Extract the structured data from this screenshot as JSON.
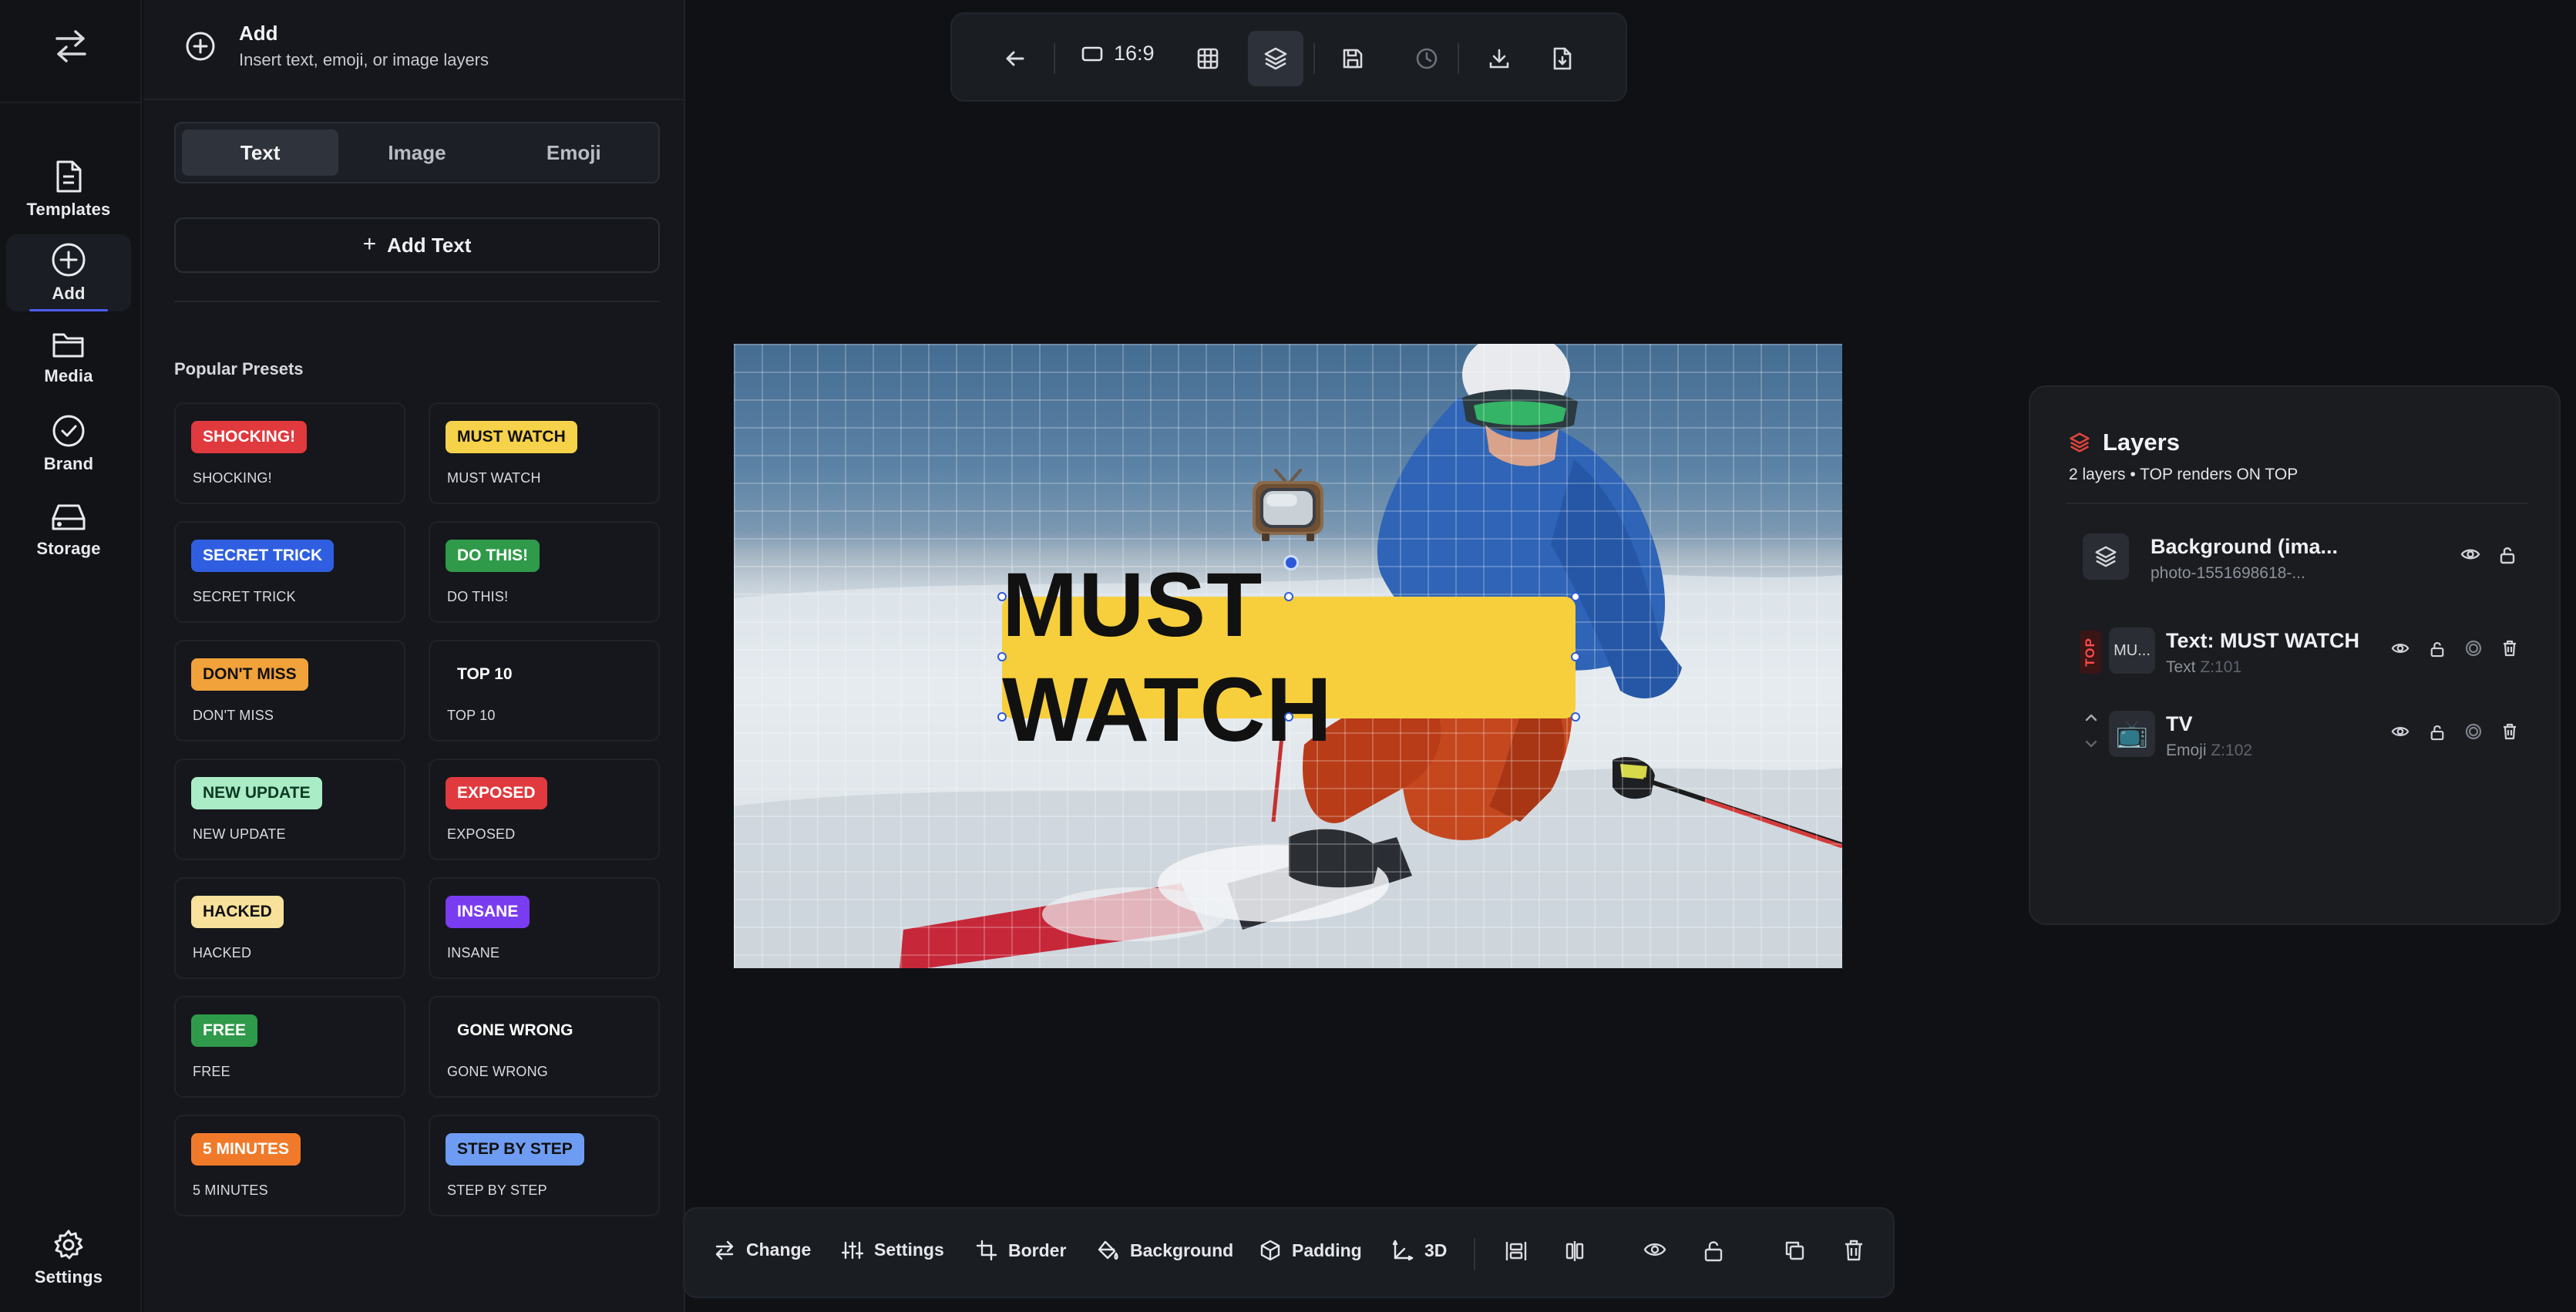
{
  "rail": {
    "items": [
      {
        "label": "Templates",
        "icon": "document-icon"
      },
      {
        "label": "Add",
        "icon": "plus-circle-icon",
        "active": true
      },
      {
        "label": "Media",
        "icon": "folder-icon"
      },
      {
        "label": "Brand",
        "icon": "check-circle-icon"
      },
      {
        "label": "Storage",
        "icon": "hard-drive-icon"
      }
    ],
    "settings_label": "Settings"
  },
  "panel": {
    "title": "Add",
    "subtitle": "Insert text, emoji, or image layers",
    "tabs": [
      "Text",
      "Image",
      "Emoji"
    ],
    "active_tab": "Text",
    "add_text_label": "Add Text",
    "presets_title": "Popular Presets",
    "presets": [
      {
        "badge": "SHOCKING!",
        "name": "SHOCKING!",
        "bg": "#e0393e",
        "fg": "#ffffff"
      },
      {
        "badge": "MUST WATCH",
        "name": "MUST WATCH",
        "bg": "#f6d24a",
        "fg": "#111111"
      },
      {
        "badge": "SECRET TRICK",
        "name": "SECRET TRICK",
        "bg": "#2f5fe0",
        "fg": "#ffffff"
      },
      {
        "badge": "DO THIS!",
        "name": "DO THIS!",
        "bg": "#2f9a4a",
        "fg": "#ffffff"
      },
      {
        "badge": "DON'T MISS",
        "name": "DON'T MISS",
        "bg": "#f2a23a",
        "fg": "#111111"
      },
      {
        "badge": "TOP 10",
        "name": "TOP 10",
        "bg": "#15171c",
        "fg": "#ffffff"
      },
      {
        "badge": "NEW UPDATE",
        "name": "NEW UPDATE",
        "bg": "#a9ecc6",
        "fg": "#0d3a22"
      },
      {
        "badge": "EXPOSED",
        "name": "EXPOSED",
        "bg": "#e0393e",
        "fg": "#ffffff"
      },
      {
        "badge": "HACKED",
        "name": "HACKED",
        "bg": "#f8e19a",
        "fg": "#111111"
      },
      {
        "badge": "INSANE",
        "name": "INSANE",
        "bg": "#7a3cf0",
        "fg": "#ffffff"
      },
      {
        "badge": "FREE",
        "name": "FREE",
        "bg": "#2f9a4a",
        "fg": "#ffffff"
      },
      {
        "badge": "GONE WRONG",
        "name": "GONE WRONG",
        "bg": "#15171c",
        "fg": "#ffffff"
      },
      {
        "badge": "5 MINUTES",
        "name": "5 MINUTES",
        "bg": "#f07a2a",
        "fg": "#ffffff"
      },
      {
        "badge": "STEP BY STEP",
        "name": "STEP BY STEP",
        "bg": "#6e9cf2",
        "fg": "#111111"
      }
    ]
  },
  "toolbar": {
    "aspect_ratio": "16:9",
    "icons": [
      "back-arrow-icon",
      "aspect-ratio-icon",
      "grid-icon",
      "layers-icon",
      "save-icon",
      "history-icon",
      "download-icon",
      "export-file-icon"
    ]
  },
  "canvas": {
    "text_layer": "MUST WATCH",
    "emoji_layer": "📺"
  },
  "layers": {
    "title": "Layers",
    "subtitle": "2 layers • TOP renders ON TOP",
    "items": [
      {
        "name": "Background (ima...",
        "meta": "photo-1551698618-...",
        "thumb": "layers-icon"
      },
      {
        "name": "Text: MUST WATCH",
        "type": "Text",
        "z": "Z:101",
        "thumb": "MU...",
        "top_tag": "TOP"
      },
      {
        "name": "TV",
        "type": "Emoji",
        "z": "Z:102",
        "thumb": "📺"
      }
    ]
  },
  "bottombar": {
    "change": "Change",
    "settings": "Settings",
    "border": "Border",
    "background": "Background",
    "padding": "Padding",
    "three_d": "3D"
  }
}
